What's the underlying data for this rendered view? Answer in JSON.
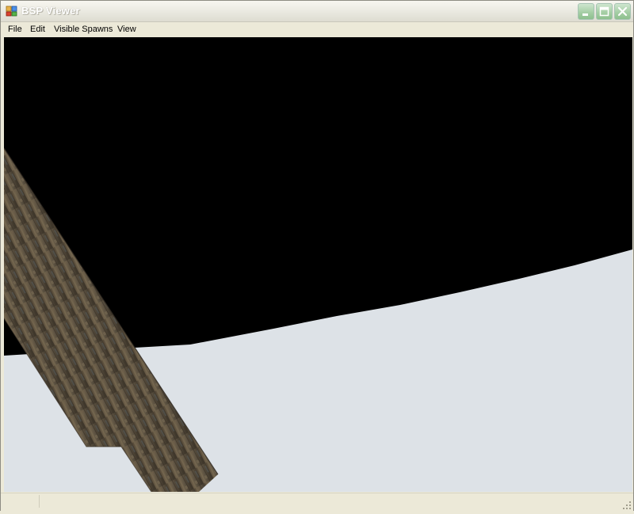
{
  "window": {
    "title": "BSP Viewer",
    "frame_color": "#ece9d8"
  },
  "menubar": {
    "items": [
      {
        "label": "File"
      },
      {
        "label": "Edit"
      },
      {
        "label": "Visible Spawns"
      },
      {
        "label": "View"
      }
    ]
  },
  "viewport": {
    "sky_color": "#000000",
    "ground_color": "#dde2e7",
    "beam_texture": "rusted-metal"
  },
  "icons": {
    "app": "app-icon",
    "minimize": "minimize-icon",
    "maximize": "maximize-icon",
    "close": "close-icon",
    "grip": "resize-grip-icon"
  }
}
